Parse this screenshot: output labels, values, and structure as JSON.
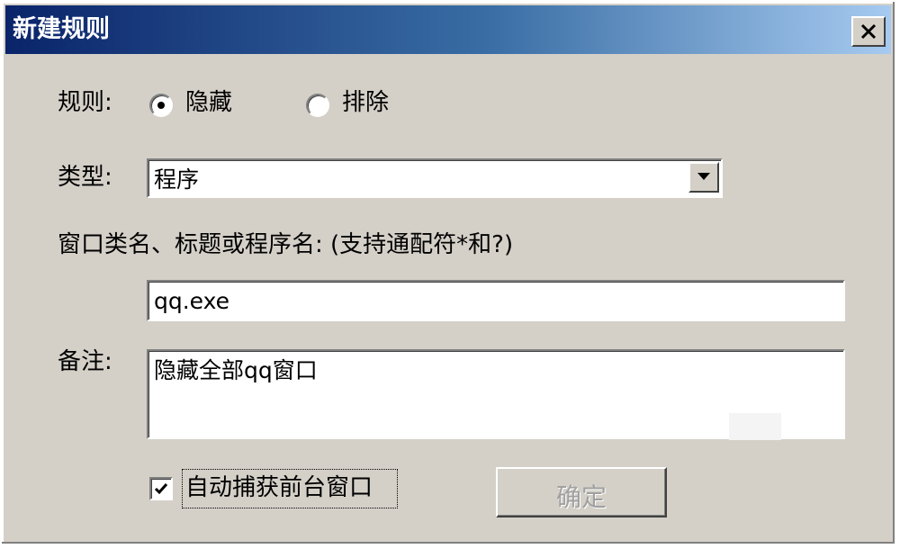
{
  "window": {
    "title": "新建规则"
  },
  "rule": {
    "label": "规则:",
    "options": [
      "隐藏",
      "排除"
    ],
    "selected": "隐藏"
  },
  "type": {
    "label": "类型:",
    "value": "程序"
  },
  "pattern": {
    "label": "窗口类名、标题或程序名: (支持通配符*和?)",
    "value": "qq.exe"
  },
  "note": {
    "label": "备注:",
    "value": "隐藏全部qq窗口"
  },
  "auto_capture": {
    "label": "自动捕获前台窗口",
    "checked": true
  },
  "ok_button": {
    "label": "确定"
  }
}
